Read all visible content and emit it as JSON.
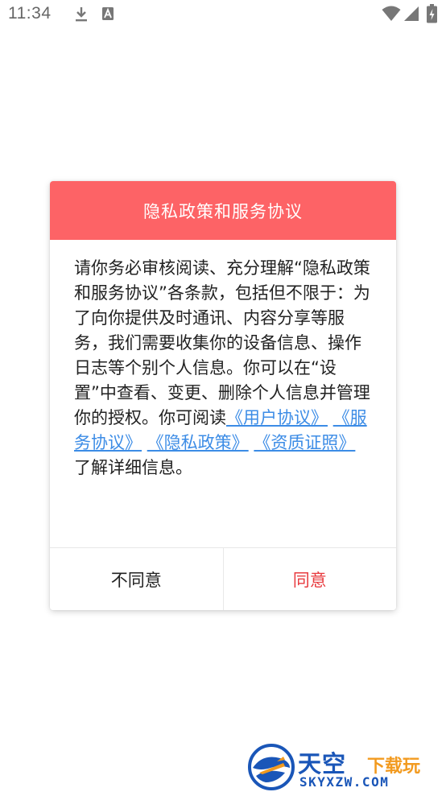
{
  "status_bar": {
    "time": "11:34",
    "icons": [
      "download-icon",
      "notification-a-icon",
      "wifi-icon",
      "signal-icon",
      "battery-charging-icon"
    ]
  },
  "dialog": {
    "title": "隐私政策和服务协议",
    "body_intro": "请你务必审核阅读、充分理解“隐私政策和服务协议”各条款，包括但不限于：为了向你提供及时通讯、内容分享等服务，我们需要收集你的设备信息、操作日志等个别个人信息。你可以在“设置”中查看、变更、删除个人信息并管理你的授权。你可阅读",
    "links": {
      "user_agreement": "《用户协议》",
      "service_agreement": "《服务协议》",
      "privacy_policy": "《隐私政策》",
      "qualification": "《资质证照》"
    },
    "body_outro": "了解详细信息。",
    "disagree_label": "不同意",
    "agree_label": "同意"
  },
  "watermark": {
    "main": "天空",
    "sub": "下载玩",
    "url": "SKYXZW.COM"
  },
  "colors": {
    "header": "#fd6366",
    "link": "#3c8ce6",
    "agree": "#e83b3f"
  }
}
